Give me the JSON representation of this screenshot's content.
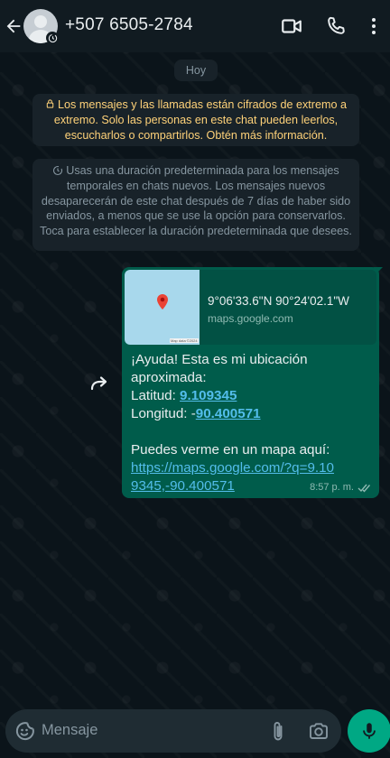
{
  "header": {
    "contact": "+507 6505-2784",
    "back_icon": "arrow-left-icon",
    "video_icon": "video-camera-icon",
    "call_icon": "phone-icon",
    "menu_icon": "more-vertical-icon"
  },
  "chat": {
    "day_label": "Hoy",
    "encryption_notice": "Los mensajes y las llamadas están cifrados de extremo a extremo. Solo las personas en este chat pueden leerlos, escucharlos o compartirlos. Obtén más información.",
    "ephemeral_notice": "Usas una duración predeterminada para los mensajes temporales en chats nuevos. Los mensajes nuevos desaparecerán de este chat después de 7 días de haber sido enviados, a menos que se use la opción para conservarlos. Toca para establecer la duración predeterminada que desees.",
    "message": {
      "preview_title": "9°06'33.6\"N 90°24'02.1\"W",
      "preview_domain": "maps.google.com",
      "map_credit": "Map data ©2024",
      "line1": "¡Ayuda! Esta es mi ubicación aproximada:",
      "lat_label": "Latitud: ",
      "lat_value": "9.109345",
      "lon_label": "Longitud: -",
      "lon_value": "90.400571",
      "line_map": "Puedes verme en un mapa aquí:",
      "url": "https://maps.google.com/?q=9.109345,-90.400571",
      "time": "8:57 p. m.",
      "status": "delivered"
    }
  },
  "composer": {
    "placeholder": "Mensaje",
    "emoji_icon": "emoji-icon",
    "attach_icon": "paperclip-icon",
    "camera_icon": "camera-icon",
    "mic_icon": "microphone-icon"
  },
  "colors": {
    "background": "#0b141a",
    "header": "#111b21",
    "outgoing_bubble": "#005c4b",
    "system_yellow": "#ffd279",
    "link": "#53bdeb",
    "accent": "#00a884"
  }
}
